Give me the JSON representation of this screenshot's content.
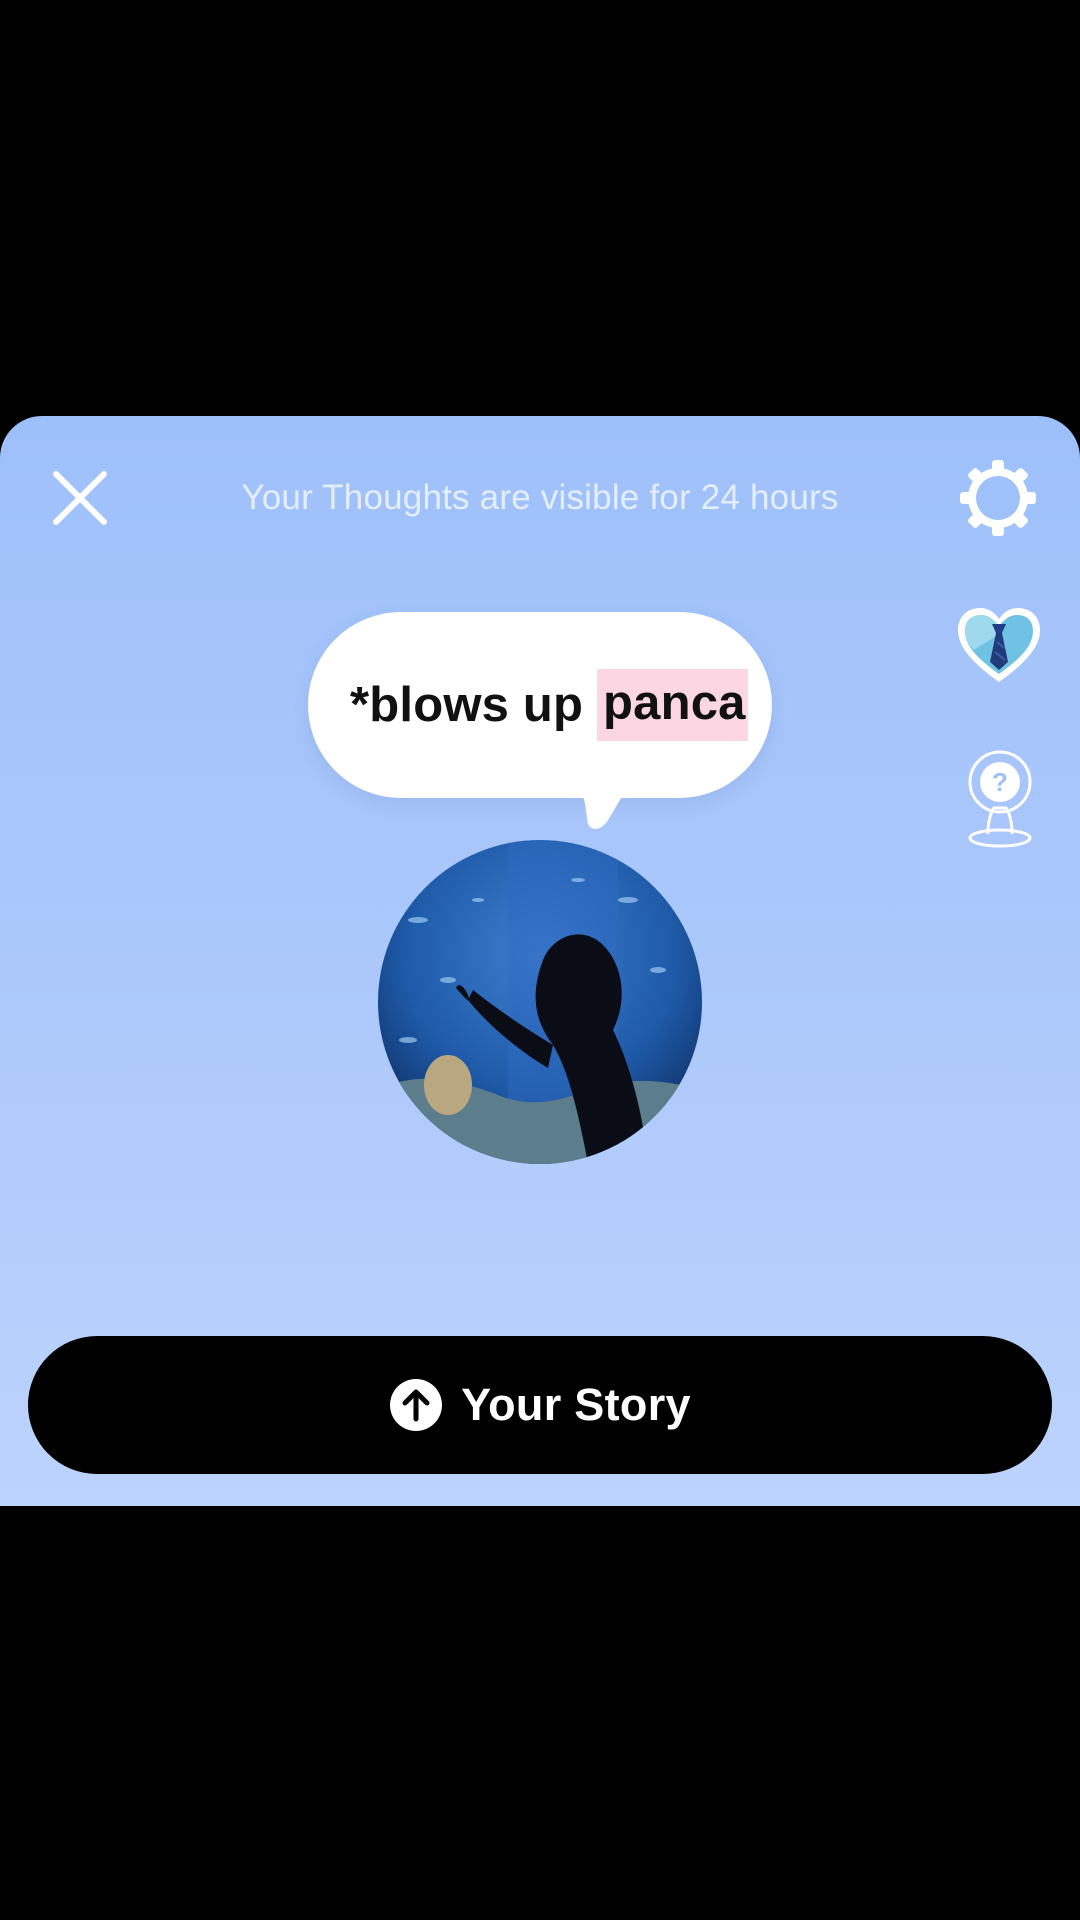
{
  "header": {
    "visibility_note": "Your Thoughts are visible for 24 hours",
    "close_icon": "close-icon",
    "settings_icon": "gear-icon"
  },
  "side_actions": [
    {
      "icon": "heart-tie-icon"
    },
    {
      "icon": "avatar-question-icon"
    }
  ],
  "thought": {
    "text_before": "*blows up ",
    "text_selected": "panca",
    "selection_color": "#fcd6e3",
    "caret_color": "#e3285f"
  },
  "avatar": {
    "icon": "profile-photo"
  },
  "story_button": {
    "label": "Your Story",
    "icon": "upload-arrow-icon"
  },
  "colors": {
    "sheet_top": "#9ec0fa",
    "sheet_bottom": "#bcd3fd",
    "button_bg": "#000000"
  }
}
